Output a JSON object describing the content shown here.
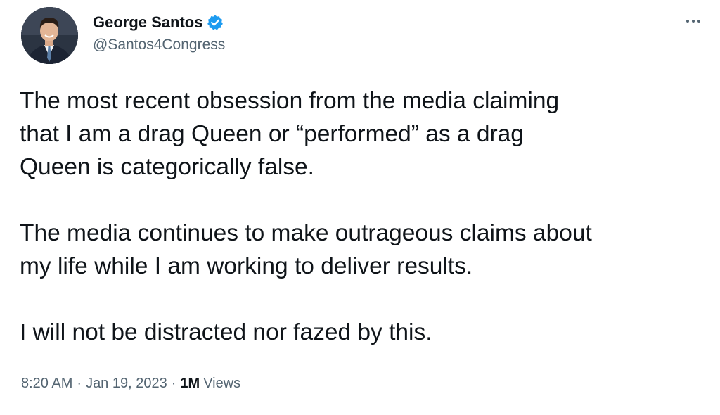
{
  "author": {
    "display_name": "George Santos",
    "handle": "@Santos4Congress",
    "verified": true,
    "avatar_icon": "profile-photo"
  },
  "more_icon": "more-horizontal-icon",
  "tweet": {
    "paragraphs": [
      "The most recent obsession from the media claiming\nthat I am a drag Queen or “performed” as a drag\nQueen is categorically false.",
      "The media continues to make outrageous claims about\nmy life while I am working to deliver results.",
      "I will not be distracted nor fazed by this."
    ]
  },
  "meta": {
    "time": "8:20 AM",
    "separator": "·",
    "date": "Jan 19, 2023",
    "views_count": "1M",
    "views_label": "Views"
  },
  "colors": {
    "text_primary": "#0f1419",
    "text_secondary": "#536471",
    "verified_blue": "#1d9bf0",
    "background": "#ffffff"
  }
}
